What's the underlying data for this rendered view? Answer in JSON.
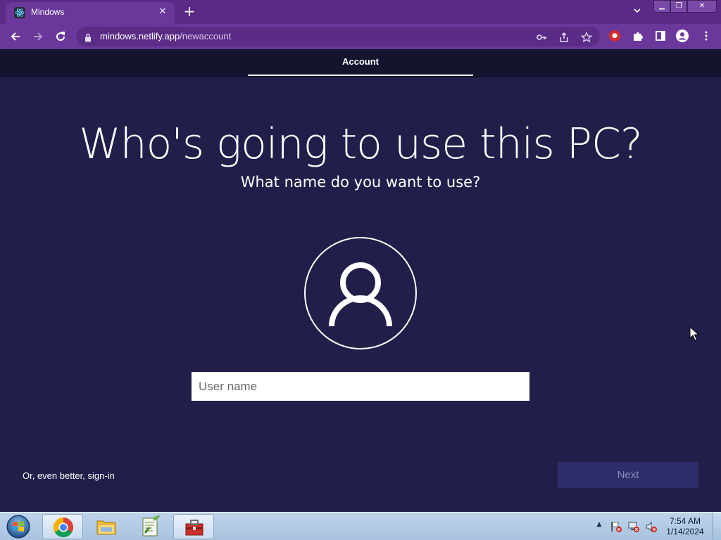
{
  "browser": {
    "tab_title": "Mindows",
    "url_domain": "mindows.netlify.app",
    "url_path": "/newaccount",
    "accent_color": "#5b2a86",
    "icons": [
      "react-favicon-icon",
      "close-icon",
      "plus-icon",
      "chevron-down-icon",
      "minimize-icon",
      "restore-icon",
      "close-window-icon",
      "back-arrow-icon",
      "forward-arrow-icon",
      "reload-icon",
      "lock-icon",
      "key-icon",
      "share-icon",
      "star-icon",
      "extension-shield-icon",
      "puzzle-icon",
      "sidebar-icon",
      "profile-icon",
      "kebab-menu-icon"
    ]
  },
  "page": {
    "step_label": "Account",
    "title": "Who's going to use this PC?",
    "subtitle": "What name do you want to use?",
    "username_placeholder": "User name",
    "username_value": "",
    "signin_link": "Or, even better, sign-in",
    "next_label": "Next",
    "background_color": "#211f4a"
  },
  "taskbar": {
    "time": "7:54 AM",
    "date": "1/14/2024",
    "apps": [
      "chrome",
      "windows-explorer",
      "notepad-plus-plus",
      "toolbox"
    ]
  }
}
